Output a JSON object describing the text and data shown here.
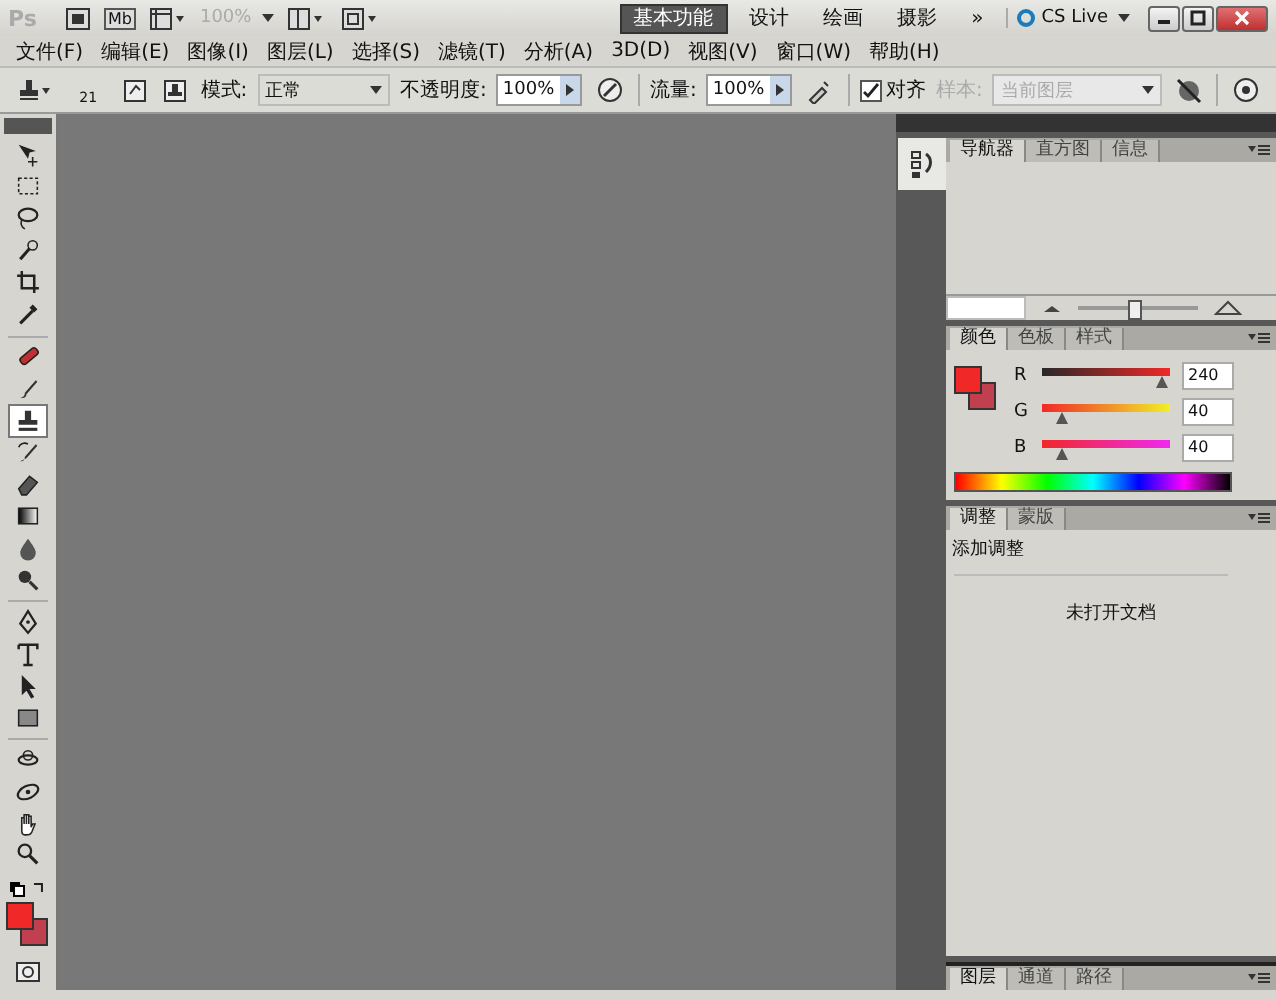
{
  "titlebar": {
    "logo": "Ps",
    "mb": "Mb",
    "zoom": "100%",
    "workspaces": [
      {
        "label": "基本功能",
        "selected": true
      },
      {
        "label": "设计",
        "selected": false
      },
      {
        "label": "绘画",
        "selected": false
      },
      {
        "label": "摄影",
        "selected": false
      }
    ],
    "more": "»",
    "cs_live": "CS Live"
  },
  "menu": [
    "文件(F)",
    "编辑(E)",
    "图像(I)",
    "图层(L)",
    "选择(S)",
    "滤镜(T)",
    "分析(A)",
    "3D(D)",
    "视图(V)",
    "窗口(W)",
    "帮助(H)"
  ],
  "options": {
    "brush_size": "21",
    "mode_label": "模式:",
    "mode": "正常",
    "opacity_label": "不透明度:",
    "opacity": "100%",
    "flow_label": "流量:",
    "flow": "100%",
    "aligned": {
      "label": "对齐",
      "checked": true
    },
    "sample_label": "样本:",
    "sample": "当前图层",
    "sample_disabled": true
  },
  "tools": [
    {
      "kind": "move",
      "selected": false
    },
    {
      "kind": "marquee",
      "selected": false
    },
    {
      "kind": "lasso",
      "selected": false
    },
    {
      "kind": "quick",
      "selected": false
    },
    {
      "kind": "crop",
      "selected": false
    },
    {
      "kind": "eyedropper",
      "selected": false
    },
    {
      "kind": "heal",
      "selected": false
    },
    {
      "kind": "brush",
      "selected": false
    },
    {
      "kind": "stamp",
      "selected": true
    },
    {
      "kind": "history",
      "selected": false
    },
    {
      "kind": "eraser",
      "selected": false
    },
    {
      "kind": "gradient",
      "selected": false
    },
    {
      "kind": "blur",
      "selected": false
    },
    {
      "kind": "dodge",
      "selected": false
    },
    {
      "kind": "pen",
      "selected": false
    },
    {
      "kind": "type",
      "selected": false
    },
    {
      "kind": "select",
      "selected": false
    },
    {
      "kind": "shape",
      "selected": false
    },
    {
      "kind": "rotate3d",
      "selected": false
    },
    {
      "kind": "orbit3d",
      "selected": false
    },
    {
      "kind": "hand",
      "selected": false
    },
    {
      "kind": "zoom",
      "selected": false
    }
  ],
  "navigator": {
    "tabs": [
      {
        "label": "导航器",
        "selected": true
      },
      {
        "label": "直方图",
        "selected": false
      },
      {
        "label": "信息",
        "selected": false
      }
    ],
    "level": 0.45
  },
  "color": {
    "tabs": [
      {
        "label": "颜色",
        "selected": true
      },
      {
        "label": "色板",
        "selected": false
      },
      {
        "label": "样式",
        "selected": false
      }
    ],
    "swatches": [
      {
        "kind": "foreground",
        "color": "#f02828"
      },
      {
        "kind": "background",
        "color": "#c04050"
      }
    ],
    "channels": [
      {
        "label": "R",
        "value": "240",
        "level": 0.94
      },
      {
        "label": "G",
        "value": "40",
        "level": 0.16
      },
      {
        "label": "B",
        "value": "40",
        "level": 0.16
      }
    ]
  },
  "adjustments": {
    "tabs": [
      {
        "label": "调整",
        "selected": true
      },
      {
        "label": "蒙版",
        "selected": false
      }
    ],
    "heading": "添加调整",
    "message": "未打开文档"
  },
  "layers": {
    "tabs": [
      {
        "label": "图层",
        "selected": true
      },
      {
        "label": "通道",
        "selected": false
      },
      {
        "label": "路径",
        "selected": false
      }
    ]
  }
}
